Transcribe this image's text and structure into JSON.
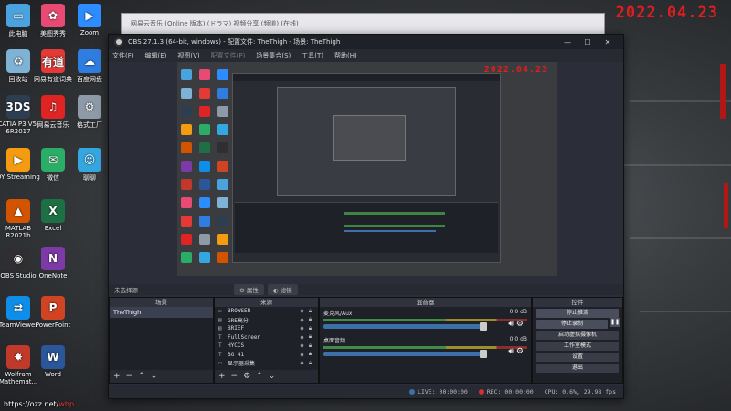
{
  "stamp": {
    "big": "2022.04.23",
    "small": "2022.04.23"
  },
  "desktop_icons": [
    {
      "label": "此电脑",
      "icon": "computer-icon",
      "color": "#4aa3df",
      "glyph": "▭"
    },
    {
      "label": "美图秀秀",
      "icon": "meitu-icon",
      "color": "#e84a73",
      "glyph": "✿"
    },
    {
      "label": "Zoom",
      "icon": "zoom-icon",
      "color": "#2d8cff",
      "glyph": "▶"
    },
    {
      "label": "回收站",
      "icon": "recycle-bin-icon",
      "color": "#7fb3d5",
      "glyph": "♻"
    },
    {
      "label": "网易有道词典",
      "icon": "youdao-icon",
      "color": "#e53935",
      "glyph": "有道"
    },
    {
      "label": "百度网盘",
      "icon": "baidu-pan-icon",
      "color": "#2f7de1",
      "glyph": "☁"
    },
    {
      "label": "CATIA P3 V5-6R2017",
      "icon": "catia-icon",
      "color": "#2c3e50",
      "glyph": "3DS"
    },
    {
      "label": "网易云音乐",
      "icon": "netease-music-icon",
      "color": "#e02424",
      "glyph": "♫"
    },
    {
      "label": "格式工厂",
      "icon": "format-factory-icon",
      "color": "#8e9aa8",
      "glyph": "⚙"
    },
    {
      "label": "DY Streaming",
      "icon": "dy-streaming-icon",
      "color": "#f39c12",
      "glyph": "▶"
    },
    {
      "label": "微信",
      "icon": "wechat-icon",
      "color": "#2aae67",
      "glyph": "✉"
    },
    {
      "label": "聊聊",
      "icon": "chat-icon",
      "color": "#35a7e0",
      "glyph": "☺"
    },
    {
      "label": "MATLAB R2021b",
      "icon": "matlab-icon",
      "color": "#d35400",
      "glyph": "▲"
    },
    {
      "label": "Excel",
      "icon": "excel-icon",
      "color": "#1d7044",
      "glyph": "X"
    },
    {
      "label": "OBS Studio",
      "icon": "obs-icon",
      "color": "#302e31",
      "glyph": "◉"
    },
    {
      "label": "OneNote",
      "icon": "onenote-icon",
      "color": "#7b3aa6",
      "glyph": "N"
    },
    {
      "label": "TeamViewer",
      "icon": "teamviewer-icon",
      "color": "#0e8ee9",
      "glyph": "⇄"
    },
    {
      "label": "PowerPoint",
      "icon": "powerpoint-icon",
      "color": "#d04423",
      "glyph": "P"
    },
    {
      "label": "Wolfram Mathemat...",
      "icon": "wolfram-icon",
      "color": "#c0392b",
      "glyph": "✸"
    },
    {
      "label": "Word",
      "icon": "word-icon",
      "color": "#2b579a",
      "glyph": "W"
    }
  ],
  "bg_window": {
    "title": "网易云音乐 (Online 版本) (ドラマ) 视频分享 (频道) (在线)"
  },
  "obs": {
    "title": "OBS 27.1.3 (64-bit, windows) - 配置文件: TheThigh - 场景: TheThigh",
    "menu": [
      "文件(F)",
      "编辑(E)",
      "视图(V)",
      "配置文件(P)",
      "场景集合(S)",
      "工具(T)",
      "帮助(H)"
    ],
    "status_left": "未选择源",
    "filter_btn": "属性",
    "filter_btn2": "滤镜",
    "docks": {
      "scenes": {
        "title": "场景",
        "items": [
          "TheThigh"
        ]
      },
      "sources": {
        "title": "来源",
        "items": [
          {
            "name": "BROWSER",
            "icon": "browser-source-icon",
            "glyph": "▭"
          },
          {
            "name": "GRE高分",
            "icon": "image-source-icon",
            "glyph": "▤"
          },
          {
            "name": "BRIEF",
            "icon": "text-source-icon",
            "glyph": "▤"
          },
          {
            "name": "FullScreen",
            "icon": "text-source-icon",
            "glyph": "T"
          },
          {
            "name": "HYCCS",
            "icon": "text-source-icon",
            "glyph": "T"
          },
          {
            "name": "BG 41",
            "icon": "text-source-icon",
            "glyph": "T"
          },
          {
            "name": "显示器采集",
            "icon": "monitor-source-icon",
            "glyph": "▭"
          }
        ]
      },
      "mixer": {
        "title": "混音器",
        "tracks": [
          {
            "name": "麦克风/Aux",
            "db": "0.0 dB",
            "level": 0.95
          },
          {
            "name": "桌面音频",
            "db": "0.0 dB",
            "level": 0.95
          }
        ]
      },
      "controls": {
        "title": "控件",
        "buttons": [
          "停止推流",
          "停止录制",
          "启动虚拟摄像机",
          "工作室模式",
          "设置",
          "退出"
        ]
      }
    },
    "statusbar": {
      "live": "LIVE: 00:00:00",
      "rec": "REC: 00:00:00",
      "cpu": "CPU: 0.6%, 29.98 fps"
    }
  },
  "url": {
    "domain": "https://ozz.net/",
    "accent": "whp"
  },
  "colors": {
    "stamp": "#e01e1e",
    "obs_bg": "#2b2e38",
    "fader": "#3d6fa8"
  }
}
